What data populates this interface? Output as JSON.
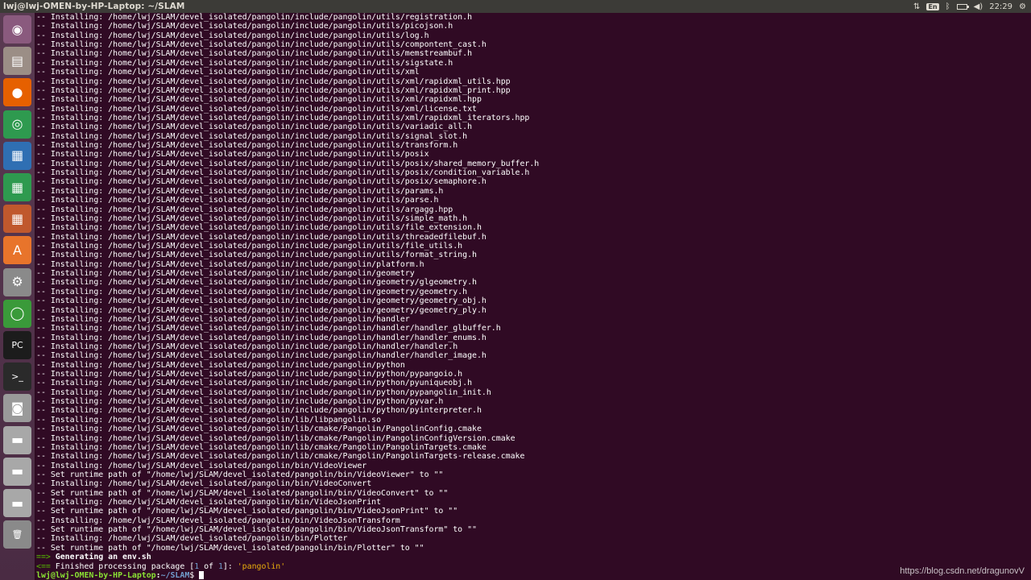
{
  "window": {
    "title": "lwj@lwj-OMEN-by-HP-Laptop: ~/SLAM"
  },
  "tray": {
    "keyboard": "En",
    "clock": "22:29"
  },
  "launcher": [
    {
      "name": "ubuntu-dash-icon",
      "bg": "#8a5a7e",
      "glyph": "◉"
    },
    {
      "name": "files-icon",
      "bg": "#9b8e86",
      "glyph": "▤"
    },
    {
      "name": "firefox-icon",
      "bg": "#e66000",
      "glyph": "●"
    },
    {
      "name": "chrome-icon",
      "bg": "#2e9a4f",
      "glyph": "◎"
    },
    {
      "name": "libreoffice-writer-icon",
      "bg": "#2f6fb3",
      "glyph": "▦"
    },
    {
      "name": "libreoffice-calc-icon",
      "bg": "#2e9a4f",
      "glyph": "▦"
    },
    {
      "name": "libreoffice-impress-icon",
      "bg": "#c0582d",
      "glyph": "▦"
    },
    {
      "name": "software-center-icon",
      "bg": "#e8742b",
      "glyph": "A"
    },
    {
      "name": "system-settings-icon",
      "bg": "#8a8a8a",
      "glyph": "⚙"
    },
    {
      "name": "update-icon",
      "bg": "#3a9a3a",
      "glyph": "◯"
    },
    {
      "name": "pycharm-icon",
      "bg": "#1c1c1c",
      "glyph": "PC"
    },
    {
      "name": "terminal-icon",
      "bg": "#2a2a2a",
      "glyph": ">_"
    },
    {
      "name": "camera-icon",
      "bg": "#9a9a9a",
      "glyph": "◙"
    },
    {
      "name": "drive-icon",
      "bg": "#a8a8a8",
      "glyph": "▬"
    },
    {
      "name": "drive-icon",
      "bg": "#a8a8a8",
      "glyph": "▬"
    },
    {
      "name": "drive-icon",
      "bg": "#a8a8a8",
      "glyph": "▬"
    },
    {
      "name": "trash-icon",
      "bg": "#8a8a8a",
      "glyph": "🗑"
    }
  ],
  "terminal": {
    "lines": [
      "-- Installing: /home/lwj/SLAM/devel_isolated/pangolin/include/pangolin/utils/registration.h",
      "-- Installing: /home/lwj/SLAM/devel_isolated/pangolin/include/pangolin/utils/picojson.h",
      "-- Installing: /home/lwj/SLAM/devel_isolated/pangolin/include/pangolin/utils/log.h",
      "-- Installing: /home/lwj/SLAM/devel_isolated/pangolin/include/pangolin/utils/compontent_cast.h",
      "-- Installing: /home/lwj/SLAM/devel_isolated/pangolin/include/pangolin/utils/memstreambuf.h",
      "-- Installing: /home/lwj/SLAM/devel_isolated/pangolin/include/pangolin/utils/sigstate.h",
      "-- Installing: /home/lwj/SLAM/devel_isolated/pangolin/include/pangolin/utils/xml",
      "-- Installing: /home/lwj/SLAM/devel_isolated/pangolin/include/pangolin/utils/xml/rapidxml_utils.hpp",
      "-- Installing: /home/lwj/SLAM/devel_isolated/pangolin/include/pangolin/utils/xml/rapidxml_print.hpp",
      "-- Installing: /home/lwj/SLAM/devel_isolated/pangolin/include/pangolin/utils/xml/rapidxml.hpp",
      "-- Installing: /home/lwj/SLAM/devel_isolated/pangolin/include/pangolin/utils/xml/license.txt",
      "-- Installing: /home/lwj/SLAM/devel_isolated/pangolin/include/pangolin/utils/xml/rapidxml_iterators.hpp",
      "-- Installing: /home/lwj/SLAM/devel_isolated/pangolin/include/pangolin/utils/variadic_all.h",
      "-- Installing: /home/lwj/SLAM/devel_isolated/pangolin/include/pangolin/utils/signal_slot.h",
      "-- Installing: /home/lwj/SLAM/devel_isolated/pangolin/include/pangolin/utils/transform.h",
      "-- Installing: /home/lwj/SLAM/devel_isolated/pangolin/include/pangolin/utils/posix",
      "-- Installing: /home/lwj/SLAM/devel_isolated/pangolin/include/pangolin/utils/posix/shared_memory_buffer.h",
      "-- Installing: /home/lwj/SLAM/devel_isolated/pangolin/include/pangolin/utils/posix/condition_variable.h",
      "-- Installing: /home/lwj/SLAM/devel_isolated/pangolin/include/pangolin/utils/posix/semaphore.h",
      "-- Installing: /home/lwj/SLAM/devel_isolated/pangolin/include/pangolin/utils/params.h",
      "-- Installing: /home/lwj/SLAM/devel_isolated/pangolin/include/pangolin/utils/parse.h",
      "-- Installing: /home/lwj/SLAM/devel_isolated/pangolin/include/pangolin/utils/argagg.hpp",
      "-- Installing: /home/lwj/SLAM/devel_isolated/pangolin/include/pangolin/utils/simple_math.h",
      "-- Installing: /home/lwj/SLAM/devel_isolated/pangolin/include/pangolin/utils/file_extension.h",
      "-- Installing: /home/lwj/SLAM/devel_isolated/pangolin/include/pangolin/utils/threadedfilebuf.h",
      "-- Installing: /home/lwj/SLAM/devel_isolated/pangolin/include/pangolin/utils/file_utils.h",
      "-- Installing: /home/lwj/SLAM/devel_isolated/pangolin/include/pangolin/utils/format_string.h",
      "-- Installing: /home/lwj/SLAM/devel_isolated/pangolin/include/pangolin/platform.h",
      "-- Installing: /home/lwj/SLAM/devel_isolated/pangolin/include/pangolin/geometry",
      "-- Installing: /home/lwj/SLAM/devel_isolated/pangolin/include/pangolin/geometry/glgeometry.h",
      "-- Installing: /home/lwj/SLAM/devel_isolated/pangolin/include/pangolin/geometry/geometry.h",
      "-- Installing: /home/lwj/SLAM/devel_isolated/pangolin/include/pangolin/geometry/geometry_obj.h",
      "-- Installing: /home/lwj/SLAM/devel_isolated/pangolin/include/pangolin/geometry/geometry_ply.h",
      "-- Installing: /home/lwj/SLAM/devel_isolated/pangolin/include/pangolin/handler",
      "-- Installing: /home/lwj/SLAM/devel_isolated/pangolin/include/pangolin/handler/handler_glbuffer.h",
      "-- Installing: /home/lwj/SLAM/devel_isolated/pangolin/include/pangolin/handler/handler_enums.h",
      "-- Installing: /home/lwj/SLAM/devel_isolated/pangolin/include/pangolin/handler/handler.h",
      "-- Installing: /home/lwj/SLAM/devel_isolated/pangolin/include/pangolin/handler/handler_image.h",
      "-- Installing: /home/lwj/SLAM/devel_isolated/pangolin/include/pangolin/python",
      "-- Installing: /home/lwj/SLAM/devel_isolated/pangolin/include/pangolin/python/pypangoio.h",
      "-- Installing: /home/lwj/SLAM/devel_isolated/pangolin/include/pangolin/python/pyuniqueobj.h",
      "-- Installing: /home/lwj/SLAM/devel_isolated/pangolin/include/pangolin/python/pypangolin_init.h",
      "-- Installing: /home/lwj/SLAM/devel_isolated/pangolin/include/pangolin/python/pyvar.h",
      "-- Installing: /home/lwj/SLAM/devel_isolated/pangolin/include/pangolin/python/pyinterpreter.h",
      "-- Installing: /home/lwj/SLAM/devel_isolated/pangolin/lib/libpangolin.so",
      "-- Installing: /home/lwj/SLAM/devel_isolated/pangolin/lib/cmake/Pangolin/PangolinConfig.cmake",
      "-- Installing: /home/lwj/SLAM/devel_isolated/pangolin/lib/cmake/Pangolin/PangolinConfigVersion.cmake",
      "-- Installing: /home/lwj/SLAM/devel_isolated/pangolin/lib/cmake/Pangolin/PangolinTargets.cmake",
      "-- Installing: /home/lwj/SLAM/devel_isolated/pangolin/lib/cmake/Pangolin/PangolinTargets-release.cmake",
      "-- Installing: /home/lwj/SLAM/devel_isolated/pangolin/bin/VideoViewer",
      "-- Set runtime path of \"/home/lwj/SLAM/devel_isolated/pangolin/bin/VideoViewer\" to \"\"",
      "-- Installing: /home/lwj/SLAM/devel_isolated/pangolin/bin/VideoConvert",
      "-- Set runtime path of \"/home/lwj/SLAM/devel_isolated/pangolin/bin/VideoConvert\" to \"\"",
      "-- Installing: /home/lwj/SLAM/devel_isolated/pangolin/bin/VideoJsonPrint",
      "-- Set runtime path of \"/home/lwj/SLAM/devel_isolated/pangolin/bin/VideoJsonPrint\" to \"\"",
      "-- Installing: /home/lwj/SLAM/devel_isolated/pangolin/bin/VideoJsonTransform",
      "-- Set runtime path of \"/home/lwj/SLAM/devel_isolated/pangolin/bin/VideoJsonTransform\" to \"\"",
      "-- Installing: /home/lwj/SLAM/devel_isolated/pangolin/bin/Plotter",
      "-- Set runtime path of \"/home/lwj/SLAM/devel_isolated/pangolin/bin/Plotter\" to \"\""
    ],
    "env_line": {
      "arrow": "==>",
      "text": " Generating an env.sh"
    },
    "finish_line": {
      "arrow": "<==",
      "pre": " Finished processing package [",
      "count": "1",
      "mid": " of ",
      "total": "1",
      "post": "]: ",
      "pkg": "'pangolin'"
    },
    "prompt": {
      "user": "lwj@lwj-OMEN-by-HP-Laptop",
      "sep": ":",
      "path": "~/SLAM",
      "symbol": "$ "
    },
    "colors": {
      "bg": "#300a24",
      "green": "#4e9a06",
      "prompt_user": "#8ae234",
      "prompt_path": "#729fcf",
      "pkg": "#e9ad0c"
    }
  },
  "watermark": "https://blog.csdn.net/dragunovV"
}
